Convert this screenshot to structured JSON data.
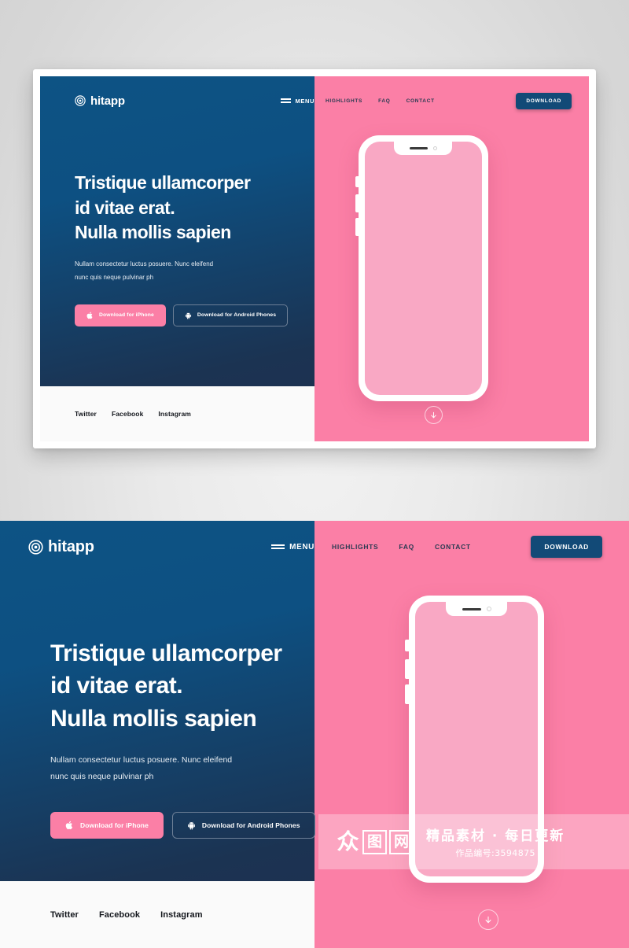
{
  "brand": {
    "name": "hitapp",
    "logo_icon": "target-circle-icon",
    "accent_pink": "#fb7fa6",
    "accent_blue": "#0d5384",
    "navy": "#1f3050",
    "screen_pink": "#f9a8c4"
  },
  "nav": {
    "menu_label": "MENU",
    "menu_icon": "hamburger-icon",
    "links": [
      {
        "label": "HIGHLIGHTS"
      },
      {
        "label": "FAQ"
      },
      {
        "label": "CONTACT"
      }
    ],
    "download_label": "DOWNLOAD"
  },
  "hero": {
    "headline_lines": [
      "Tristique ullamcorper",
      "id vitae erat.",
      "Nulla mollis sapien"
    ],
    "subcopy_lines": [
      "Nullam consectetur luctus posuere. Nunc eleifend",
      "nunc quis neque pulvinar ph"
    ],
    "buttons": [
      {
        "label": "Download for iPhone",
        "icon": "apple-icon",
        "style": "filled"
      },
      {
        "label": "Download for Android Phones",
        "icon": "android-icon",
        "style": "outline"
      }
    ]
  },
  "social": {
    "links": [
      {
        "label": "Twitter"
      },
      {
        "label": "Facebook"
      },
      {
        "label": "Instagram"
      }
    ]
  },
  "phone": {
    "notch_speaker_icon": "speaker-grille-icon",
    "notch_camera_icon": "front-camera-icon",
    "side_buttons": 3
  },
  "scroll_indicator": {
    "icon": "arrow-down-icon"
  },
  "watermark": {
    "logo_chars": [
      "众",
      "图",
      "网"
    ],
    "tagline": "精品素材 · 每日更新",
    "work_id": "作品编号:3594875"
  }
}
